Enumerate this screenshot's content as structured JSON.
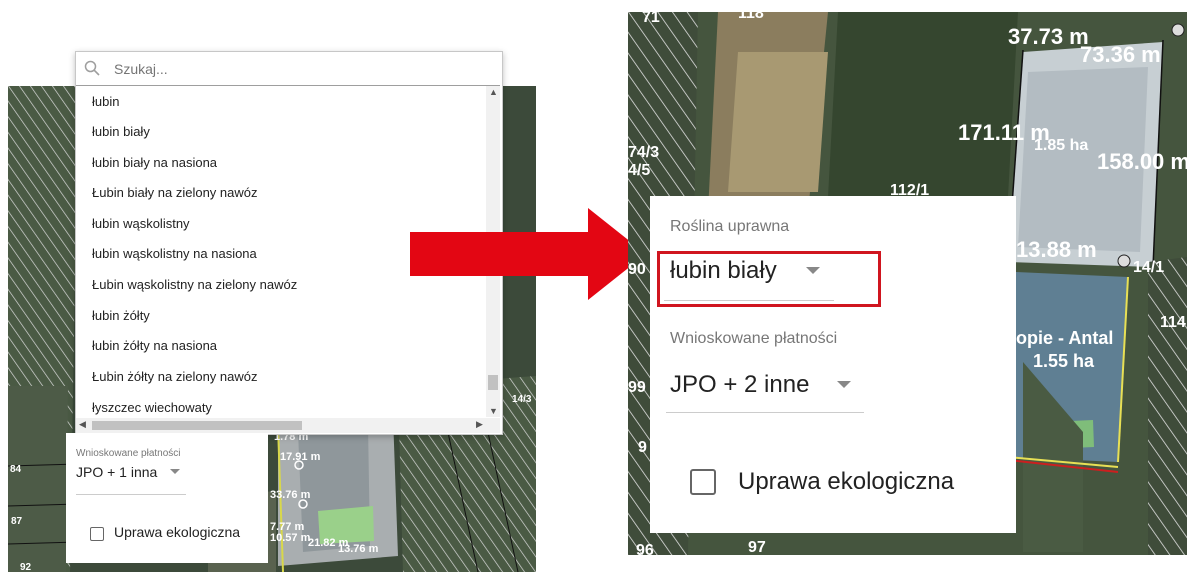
{
  "left": {
    "search": {
      "placeholder": "Szukaj...",
      "value": ""
    },
    "options": [
      "łubin",
      "łubin biały",
      "łubin biały na nasiona",
      "Łubin biały na zielony nawóz",
      "łubin wąskolistny",
      "łubin wąskolistny na nasiona",
      "Łubin wąskolistny na zielony nawóz",
      "łubin żółty",
      "łubin żółty na nasiona",
      "Łubin żółty na zielony nawóz",
      "łyszczec wiechowaty"
    ],
    "payments_label": "Wnioskowane płatności",
    "payments_value": "JPO + 1 inna",
    "eco_label": "Uprawa ekologiczna",
    "map_labels": {
      "l1": "1.78 m",
      "l2": "17.91 m",
      "l3": "33.76 m",
      "l4": "7.77 m",
      "l5": "10.57 m",
      "l6": "21.82 m",
      "l7": "13.76 m",
      "l8": "14/3",
      "l9": "84",
      "l10": "87",
      "l11": "92"
    }
  },
  "right": {
    "crop_label": "Roślina uprawna",
    "crop_value": "łubin biały",
    "payments_label": "Wnioskowane płatności",
    "payments_value": "JPO + 2 inne",
    "eco_label": "Uprawa ekologiczna",
    "map_labels": {
      "r1": "37.73 m",
      "r2": "73.36 m",
      "r3": "171.11 m",
      "r4": "1.85 ha",
      "r5": "158.00 m",
      "r6": "112/1",
      "r7": "74/3",
      "r8": "4/5",
      "r9": "13.88 m",
      "r10": "14/1",
      "r11": "114",
      "r12": "opie - Antal",
      "r13": "1.55 ha",
      "r14": "99",
      "r15": "90",
      "r16": "97",
      "r17": "96",
      "r18": "9",
      "r19": "71",
      "r20": "118"
    }
  },
  "colors": {
    "arrow": "#e30613",
    "highlight": "#d0151f"
  }
}
